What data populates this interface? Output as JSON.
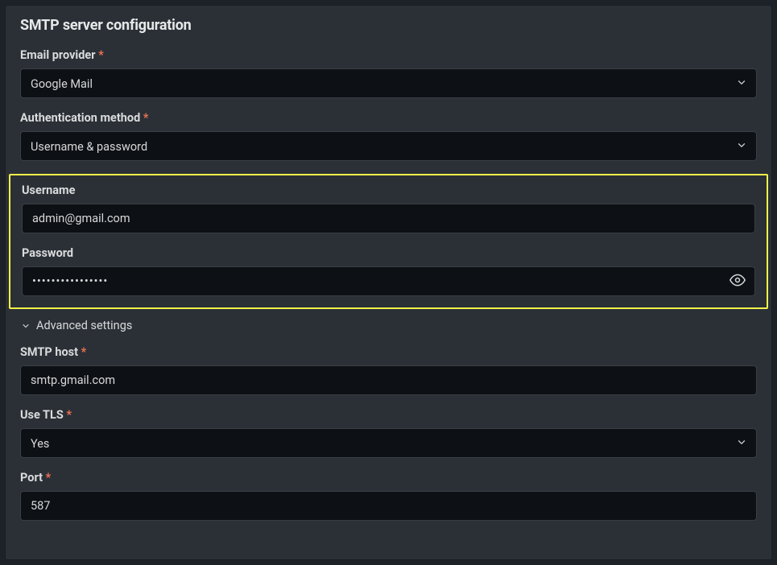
{
  "section": {
    "title": "SMTP server configuration"
  },
  "fields": {
    "email_provider": {
      "label": "Email provider",
      "required": "*",
      "value": "Google Mail"
    },
    "auth_method": {
      "label": "Authentication method",
      "required": "*",
      "value": "Username & password"
    },
    "username": {
      "label": "Username",
      "value": "admin@gmail.com"
    },
    "password": {
      "label": "Password",
      "value": "••••••••••••••••"
    },
    "advanced_label": "Advanced settings",
    "smtp_host": {
      "label": "SMTP host",
      "required": "*",
      "value": "smtp.gmail.com"
    },
    "use_tls": {
      "label": "Use TLS",
      "required": "*",
      "value": "Yes"
    },
    "port": {
      "label": "Port",
      "required": "*",
      "value": "587"
    }
  }
}
